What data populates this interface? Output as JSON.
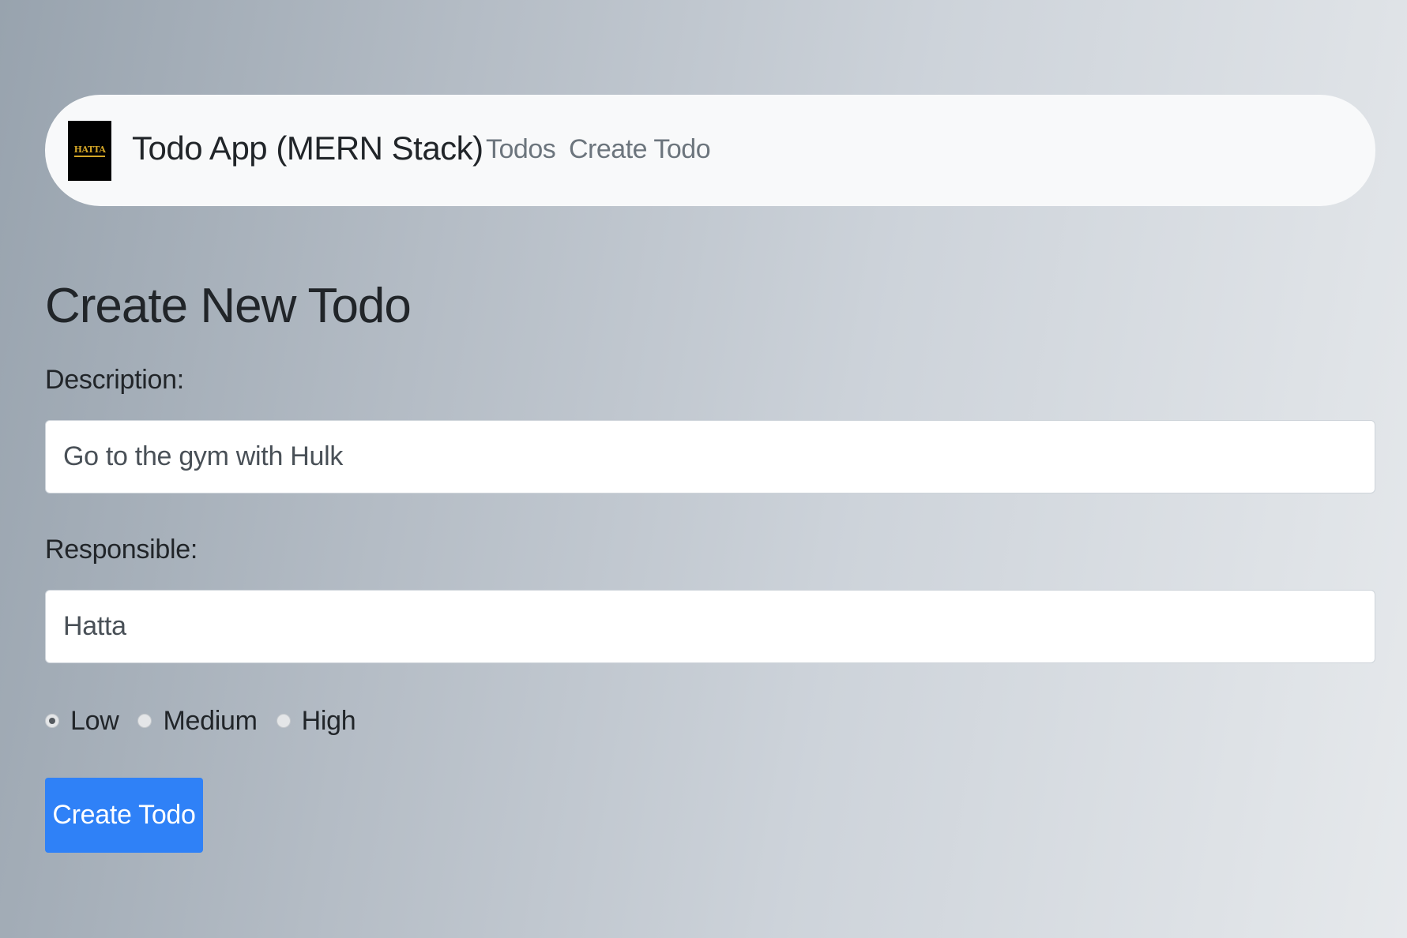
{
  "navbar": {
    "logo_text": "HATTA",
    "brand_title": "Todo App (MERN Stack)",
    "links": [
      {
        "label": "Todos"
      },
      {
        "label": "Create Todo"
      }
    ]
  },
  "form": {
    "title": "Create New Todo",
    "description": {
      "label": "Description:",
      "value": "Go to the gym with Hulk"
    },
    "responsible": {
      "label": "Responsible:",
      "value": "Hatta"
    },
    "priority": {
      "selected": "Low",
      "options": [
        {
          "label": "Low",
          "checked": true
        },
        {
          "label": "Medium",
          "checked": false
        },
        {
          "label": "High",
          "checked": false
        }
      ]
    },
    "submit_label": "Create Todo"
  },
  "colors": {
    "primary": "#2f81f7",
    "navbar_bg": "#f8f9fa",
    "logo_gold": "#d4a627"
  }
}
